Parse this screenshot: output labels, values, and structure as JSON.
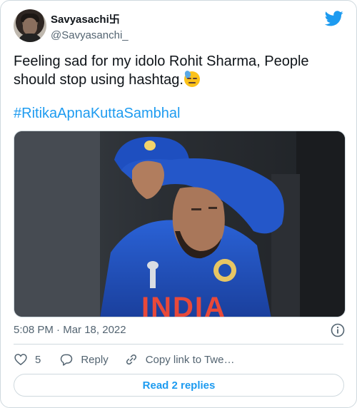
{
  "author": {
    "display_name": "Savyasachi卐",
    "handle": "@Savyasanchi_"
  },
  "tweet": {
    "text": "Feeling sad for my idolo Rohit Sharma, People should stop using hashtag.",
    "emoji": "downcast-face-with-sweat",
    "hashtag": "#RitikaApnaKuttaSambhal",
    "jersey_text": "INDIA"
  },
  "meta": {
    "time": "5:08 PM",
    "separator": "·",
    "date": "Mar 18, 2022"
  },
  "actions": {
    "likes": "5",
    "reply_label": "Reply",
    "copy_link_label": "Copy link to Twe…"
  },
  "read_replies_label": "Read 2 replies",
  "colors": {
    "accent": "#1d9bf0",
    "text": "#0f1419",
    "secondary": "#536471",
    "border": "#cfd9de",
    "jersey": "#1f4fb5"
  }
}
